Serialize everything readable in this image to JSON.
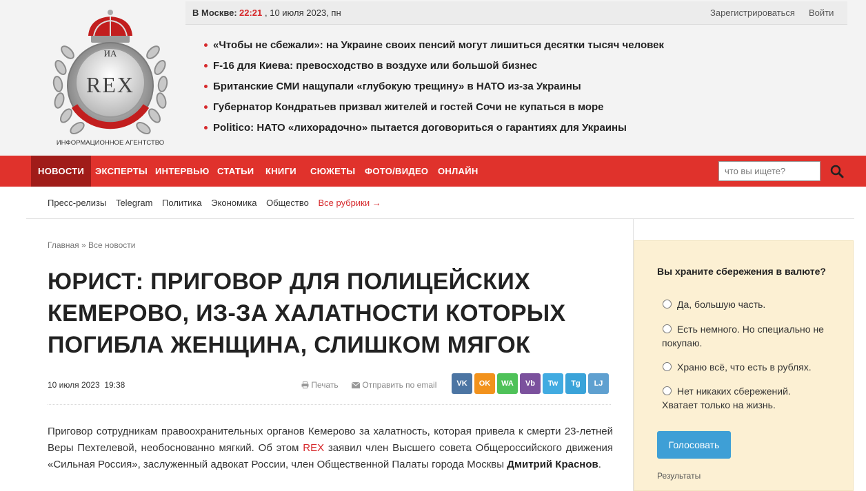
{
  "topbar": {
    "city_label": "В Москве:",
    "time": "22:21",
    "date": ", 10 июля 2023, пн",
    "register": "Зарегистрироваться",
    "login": "Войти"
  },
  "logo": {
    "ia": "ИА",
    "rex": "REX",
    "caption": "ИНФОРМАЦИОННОЕ АГЕНТСТВО"
  },
  "headlines": [
    "«Чтобы не сбежали»: на Украине своих пенсий могут лишиться десятки тысяч человек",
    "F-16 для Киева: превосходство в воздухе или большой бизнес",
    "Британские СМИ нащупали «глубокую трещину» в НАТО из-за Украины",
    "Губернатор Кондратьев призвал жителей и гостей Сочи не купаться в море",
    "Politico: НАТО «лихорадочно» пытается договориться о гарантиях для Украины"
  ],
  "nav": {
    "items": [
      "НОВОСТИ",
      "ЭКСПЕРТЫ",
      "ИНТЕРВЬЮ",
      "СТАТЬИ",
      "КНИГИ",
      "СЮЖЕТЫ",
      "ФОТО/ВИДЕО",
      "ОНЛАЙН"
    ],
    "search_placeholder": "что вы ищете?"
  },
  "subnav": {
    "items": [
      "Пресс-релизы",
      "Telegram",
      "Политика",
      "Экономика",
      "Общество"
    ],
    "all": "Все рубрики →"
  },
  "breadcrumb": {
    "home": "Главная",
    "sep": " » ",
    "current": "Все новости"
  },
  "article": {
    "title": "Юрист: приговор для полицейских Кемерово, из-за халатности которых погибла женщина, слишком мягок",
    "date": "10 июля 2023",
    "time": "19:38",
    "print": "Печать",
    "email": "Отправить по email",
    "body_part1": "Приговор сотрудникам правоохранительных органов Кемерово за халатность, которая привела к смерти 23-летней Веры Пехтелевой, необоснованно мягкий. Об этом ",
    "body_rex": "REX",
    "body_part2": " заявил член Высшего совета Общероссийского движения «Сильная Россия», заслуженный адвокат России, член Общественной Палаты города Москвы ",
    "body_person": "Дмитрий Краснов",
    "body_end": "."
  },
  "share": [
    {
      "icon": "vk-icon",
      "label": "VK",
      "color": "#4c75a3"
    },
    {
      "icon": "odnoklassniki-icon",
      "label": "OK",
      "color": "#f2921c"
    },
    {
      "icon": "whatsapp-icon",
      "label": "WA",
      "color": "#4fc259"
    },
    {
      "icon": "viber-icon",
      "label": "Vb",
      "color": "#7b519d"
    },
    {
      "icon": "twitter-icon",
      "label": "Tw",
      "color": "#41abe1"
    },
    {
      "icon": "telegram-icon",
      "label": "Tg",
      "color": "#3aa3d9"
    },
    {
      "icon": "livejournal-icon",
      "label": "LJ",
      "color": "#5fa0d0"
    }
  ],
  "poll": {
    "question": "Вы храните сбережения в валюте?",
    "options": [
      "Да, большую часть.",
      "Есть немного. Но специально не покупаю.",
      "Храню всё, что есть в рублях.",
      "Нет никаких сбережений. Хватает только на жизнь."
    ],
    "vote": "Голосовать",
    "results": "Результаты"
  },
  "colors": {
    "accent_red": "#e0322c",
    "active_nav": "#a01c19",
    "poll_bg": "#fcf0d3",
    "vote_button": "#3e9fd6"
  }
}
